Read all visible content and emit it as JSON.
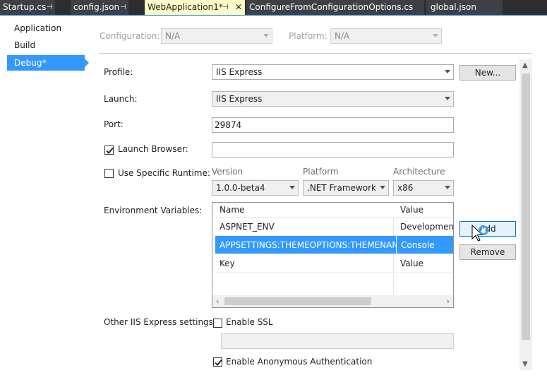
{
  "tabs": [
    {
      "label": "Startup.cs",
      "pinned": true,
      "active": false
    },
    {
      "label": "config.json",
      "pinned": true,
      "active": false
    },
    {
      "label": "WebApplication1*",
      "pinned": true,
      "active": true
    },
    {
      "label": "ConfigureFromConfigurationOptions.cs",
      "pinned": false,
      "active": false
    },
    {
      "label": "global.json",
      "pinned": false,
      "active": false
    }
  ],
  "nav": {
    "items": [
      {
        "label": "Application"
      },
      {
        "label": "Build"
      },
      {
        "label": "Debug*"
      }
    ],
    "selected_index": 2
  },
  "top": {
    "configuration_label": "Configuration:",
    "configuration_value": "N/A",
    "platform_label": "Platform:",
    "platform_value": "N/A"
  },
  "form": {
    "profile_label": "Profile:",
    "profile_value": "IIS Express",
    "new_button": "New...",
    "launch_label": "Launch:",
    "launch_value": "IIS Express",
    "port_label": "Port:",
    "port_value": "29874",
    "launch_browser_label": "Launch Browser:",
    "launch_browser_checked": true,
    "launch_browser_value": "",
    "specific_runtime_label": "Use Specific Runtime:",
    "specific_runtime_checked": false,
    "version_header": "Version",
    "version_value": "1.0.0-beta4",
    "platform_header": "Platform",
    "platform_value": ".NET Framework",
    "architecture_header": "Architecture",
    "architecture_value": "x86",
    "env_vars_label": "Environment Variables:",
    "env_grid": {
      "columns": [
        "Name",
        "Value"
      ],
      "rows": [
        {
          "name": "ASPNET_ENV",
          "value": "Development",
          "selected": false
        },
        {
          "name": "APPSETTINGS:THEMEOPTIONS:THEMENAME",
          "value": "Console",
          "selected": true
        },
        {
          "name": "Key",
          "value": "Value",
          "selected": false
        }
      ]
    },
    "add_button": "Add",
    "remove_button": "Remove",
    "iis_settings_label": "Other IIS Express settings:",
    "enable_ssl_label": "Enable SSL",
    "enable_ssl_checked": false,
    "ssl_url_value": "",
    "anon_auth_label": "Enable Anonymous Authentication",
    "anon_auth_checked": true
  },
  "colors": {
    "accent": "#3399ff",
    "tabstrip": "#2d2d30",
    "active_tab": "#fefcc8",
    "tab_underline": "#007acc"
  },
  "icons": {
    "pin": "pin-icon",
    "close": "close-icon",
    "check": "checkmark-icon",
    "dropdown": "chevron-down-icon",
    "cursor": "mouse-pointer-icon"
  }
}
